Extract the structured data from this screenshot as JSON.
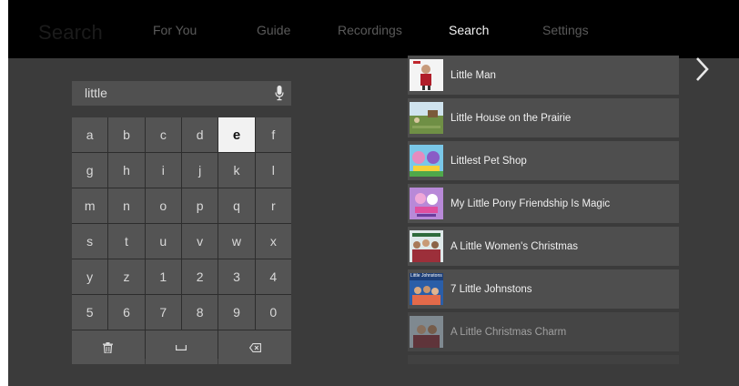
{
  "header": {
    "page_title": "Search",
    "tabs": [
      {
        "label": "For You",
        "active": false
      },
      {
        "label": "Guide",
        "active": false
      },
      {
        "label": "Recordings",
        "active": false
      },
      {
        "label": "Search",
        "active": true
      },
      {
        "label": "Settings",
        "active": false
      }
    ]
  },
  "search": {
    "query": "little",
    "mic_icon": "microphone-icon"
  },
  "keyboard": {
    "selected_key": "e",
    "rows": [
      [
        "a",
        "b",
        "c",
        "d",
        "e",
        "f"
      ],
      [
        "g",
        "h",
        "i",
        "j",
        "k",
        "l"
      ],
      [
        "m",
        "n",
        "o",
        "p",
        "q",
        "r"
      ],
      [
        "s",
        "t",
        "u",
        "v",
        "w",
        "x"
      ],
      [
        "y",
        "z",
        "1",
        "2",
        "3",
        "4"
      ],
      [
        "5",
        "6",
        "7",
        "8",
        "9",
        "0"
      ]
    ],
    "function_keys": [
      {
        "name": "delete-all-key",
        "icon": "trash-icon"
      },
      {
        "name": "space-key",
        "icon": "space-bar-icon"
      },
      {
        "name": "backspace-key",
        "icon": "backspace-icon"
      }
    ]
  },
  "results": [
    {
      "title": "Little Man"
    },
    {
      "title": "Little House on the Prairie"
    },
    {
      "title": "Littlest Pet Shop"
    },
    {
      "title": "My Little Pony Friendship Is Magic"
    },
    {
      "title": "A Little Women's Christmas"
    },
    {
      "title": "7 Little Johnstons",
      "thumb_caption": "Little Johnstons"
    },
    {
      "title": "A Little Christmas Charm"
    }
  ],
  "colors": {
    "background": "#3b3b3b",
    "topbar": "#000000",
    "tile": "#4e4e4e",
    "key": "#545454",
    "selected_key": "#f2f2f2"
  },
  "next_icon": "chevron-right-icon"
}
